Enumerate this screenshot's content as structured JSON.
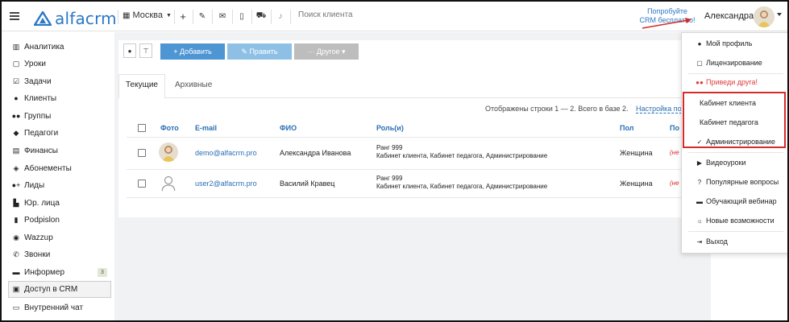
{
  "topbar": {
    "logo_text": "alfacrm",
    "branch": "Москва",
    "search_placeholder": "Поиск клиента",
    "promo_line1": "Попробуйте",
    "promo_line2": "CRM бесплатно!",
    "username": "Александра"
  },
  "sidebar": {
    "items": [
      {
        "label": "Аналитика",
        "icon": "chart-icon"
      },
      {
        "label": "Уроки",
        "icon": "calendar-icon"
      },
      {
        "label": "Задачи",
        "icon": "tasks-icon"
      },
      {
        "label": "Клиенты",
        "icon": "user-icon"
      },
      {
        "label": "Группы",
        "icon": "users-icon"
      },
      {
        "label": "Педагоги",
        "icon": "graduation-cap-icon"
      },
      {
        "label": "Финансы",
        "icon": "money-icon"
      },
      {
        "label": "Абонементы",
        "icon": "tag-icon"
      },
      {
        "label": "Лиды",
        "icon": "user-plus-icon"
      },
      {
        "label": "Юр. лица",
        "icon": "bank-icon"
      },
      {
        "label": "Podpislon",
        "icon": "file-icon"
      },
      {
        "label": "Wazzup",
        "icon": "whatsapp-icon"
      },
      {
        "label": "Звонки",
        "icon": "phone-icon"
      },
      {
        "label": "Информер",
        "icon": "book-icon"
      },
      {
        "label": "Доступ в CRM",
        "icon": "lock-icon"
      },
      {
        "label": "Внутренний чат",
        "icon": "chat-icon"
      }
    ],
    "informer_badge": "3"
  },
  "toolbar": {
    "add": "+ Добавить",
    "edit": "✎ Править",
    "other": "··· Другое ▾"
  },
  "tabs": {
    "current": "Текущие",
    "archive": "Архивные"
  },
  "table": {
    "info": "Отображены строки 1 — 2. Всего в базе 2.",
    "settings_link": "Настройка по",
    "headers": {
      "photo": "Фото",
      "email": "E-mail",
      "fio": "ФИО",
      "role": "Роль(и)",
      "gender": "Пол",
      "last": "По"
    },
    "rows": [
      {
        "email": "demo@alfacrm.pro",
        "fio": "Александра Иванова",
        "rank": "Ранг 999",
        "roles": "Кабинет клиента, Кабинет педагога, Администрирование",
        "gender": "Женщина",
        "last": "(не"
      },
      {
        "email": "user2@alfacrm.pro",
        "fio": "Василий Кравец",
        "rank": "Ранг 999",
        "roles": "Кабинет клиента, Кабинет педагога, Администрирование",
        "gender": "Женщина",
        "last": "(не"
      }
    ]
  },
  "dropdown": {
    "profile": "Мой профиль",
    "licensing": "Лицензирование",
    "invite": "Приведи друга!",
    "client_cabinet": "Кабинет клиента",
    "teacher_cabinet": "Кабинет педагога",
    "admin": "Администрирование",
    "videos": "Видеоуроки",
    "faq": "Популярные вопросы",
    "webinar": "Обучающий вебинар",
    "whatsnew": "Новые возможности",
    "logout": "Выход"
  },
  "colors": {
    "accent": "#2a78c6",
    "btn_add": "#4e95d4",
    "btn_edit": "#8ec0e6",
    "btn_other": "#bdbdbd",
    "highlight": "#d62b2b",
    "invite": "#e0393b"
  }
}
